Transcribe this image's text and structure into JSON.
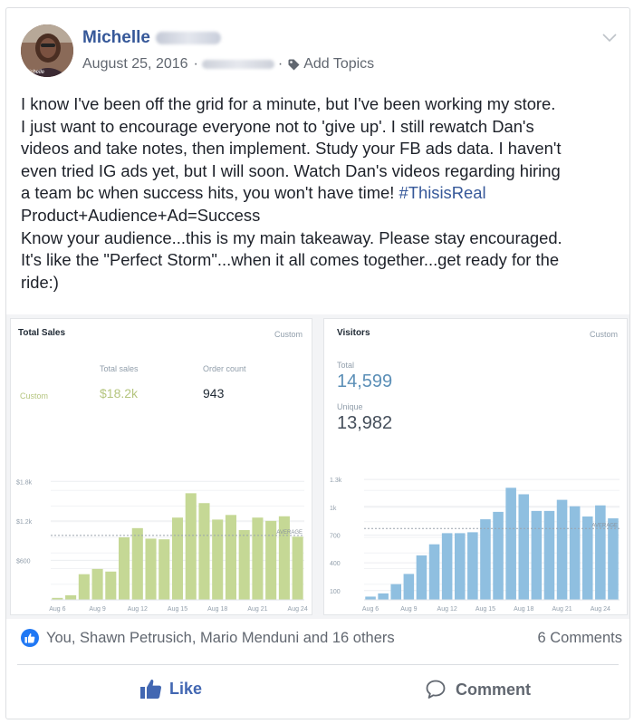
{
  "post": {
    "author_first": "Michelle",
    "date": "August 25, 2016",
    "separator": "·",
    "add_topics": "Add Topics",
    "lines": [
      "I know I've been off the grid for a minute, but I've been working my store.",
      "I just want to encourage everyone not to 'give up'. I still rewatch Dan's",
      "videos and take notes, then implement. Study your FB ads data. I haven't",
      "even tried IG ads yet, but I will soon. Watch Dan's videos regarding hiring",
      "a team bc when success hits, you won't have time! ",
      "Product+Audience+Ad=Success",
      "Know your audience...this is my main takeaway. Please stay encouraged.",
      "It's like the \"Perfect Storm\"...when it all comes together...get ready for the",
      "ride:)"
    ],
    "hashtag": "#ThisisReal"
  },
  "sales_panel": {
    "title": "Total Sales",
    "custom": "Custom",
    "total_sales_label": "Total sales",
    "order_count_label": "Order count",
    "row_label": "Custom",
    "total_sales_value": "$18.2k",
    "order_count_value": "943"
  },
  "visitors_panel": {
    "title": "Visitors",
    "custom": "Custom",
    "total_label": "Total",
    "total_value": "14,599",
    "unique_label": "Unique",
    "unique_value": "13,982"
  },
  "chart_data": [
    {
      "type": "bar",
      "title": "Total Sales",
      "color": "#c5d895",
      "categories": [
        "Aug 6",
        "Aug 7",
        "Aug 8",
        "Aug 9",
        "Aug 10",
        "Aug 11",
        "Aug 12",
        "Aug 13",
        "Aug 14",
        "Aug 15",
        "Aug 16",
        "Aug 17",
        "Aug 18",
        "Aug 19",
        "Aug 20",
        "Aug 21",
        "Aug 22",
        "Aug 23",
        "Aug 24"
      ],
      "x_tick_labels": [
        "Aug 6",
        "Aug 9",
        "Aug 12",
        "Aug 15",
        "Aug 18",
        "Aug 21",
        "Aug 24"
      ],
      "values": [
        30,
        70,
        390,
        470,
        430,
        950,
        1090,
        930,
        920,
        1250,
        1620,
        1470,
        1220,
        1290,
        1060,
        1250,
        1200,
        1270,
        960
      ],
      "y_ticks": [
        600,
        1200,
        1800
      ],
      "y_tick_labels": [
        "$600",
        "$1.2k",
        "$1.8k"
      ],
      "ylim": [
        0,
        1900
      ],
      "average": 980,
      "average_label": "AVERAGE"
    },
    {
      "type": "bar",
      "title": "Visitors",
      "color": "#8fbfe0",
      "categories": [
        "Aug 6",
        "Aug 7",
        "Aug 8",
        "Aug 9",
        "Aug 10",
        "Aug 11",
        "Aug 12",
        "Aug 13",
        "Aug 14",
        "Aug 15",
        "Aug 16",
        "Aug 17",
        "Aug 18",
        "Aug 19",
        "Aug 20",
        "Aug 21",
        "Aug 22",
        "Aug 23",
        "Aug 24"
      ],
      "x_tick_labels": [
        "Aug 6",
        "Aug 9",
        "Aug 12",
        "Aug 15",
        "Aug 18",
        "Aug 21",
        "Aug 24"
      ],
      "values": [
        35,
        70,
        170,
        280,
        480,
        600,
        720,
        720,
        730,
        870,
        950,
        1210,
        1140,
        960,
        960,
        1080,
        1010,
        900,
        1020,
        880
      ],
      "y_ticks": [
        100,
        400,
        700,
        1000,
        1300
      ],
      "y_tick_labels": [
        "100",
        "400",
        "700",
        "1k",
        "1.3k"
      ],
      "ylim": [
        0,
        1350
      ],
      "average": 770,
      "average_label": "AVERAGE"
    }
  ],
  "footer": {
    "reactions_text": "You, Shawn Petrusich, Mario Menduni and 16 others",
    "comments_text": "6 Comments",
    "like_label": "Like",
    "comment_label": "Comment",
    "brand_blue": "#365899",
    "like_blue": "#2078f4"
  }
}
